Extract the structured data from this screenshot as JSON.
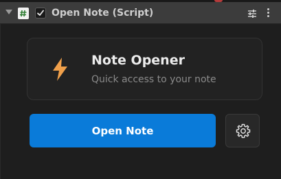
{
  "header": {
    "title": "Open Note (Script)",
    "icons": [
      "foldout-arrow-icon",
      "script-icon",
      "enabled-checkbox",
      "presets-icon",
      "kebab-menu-icon"
    ],
    "enabled": true
  },
  "card": {
    "icon": "lightning-bolt-icon",
    "title": "Note Opener",
    "subtitle": "Quick access to your note"
  },
  "actions": {
    "open_label": "Open Note",
    "settings_icon": "gear-icon"
  },
  "colors": {
    "accent": "#0a7bd9",
    "bolt": "#f0a04b",
    "background": "#1e1e1e",
    "header": "#3c3c3c"
  }
}
